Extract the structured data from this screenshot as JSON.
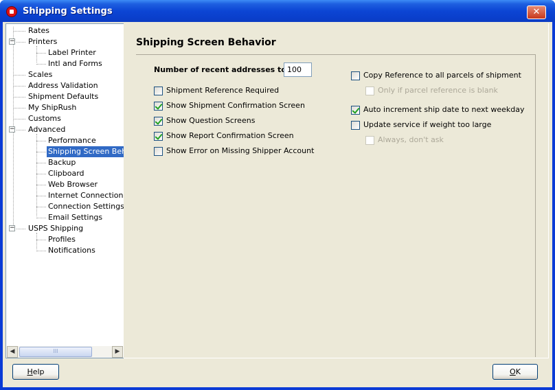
{
  "window": {
    "title": "Shipping Settings",
    "close_symbol": "✕"
  },
  "tree": {
    "items": [
      {
        "label": "Rates",
        "level": 0
      },
      {
        "label": "Printers",
        "level": 0,
        "expander": "−"
      },
      {
        "label": "Label Printer",
        "level": 1
      },
      {
        "label": "Intl and Forms",
        "level": 1
      },
      {
        "label": "Scales",
        "level": 0
      },
      {
        "label": "Address Validation",
        "level": 0
      },
      {
        "label": "Shipment Defaults",
        "level": 0
      },
      {
        "label": "My ShipRush",
        "level": 0
      },
      {
        "label": "Customs",
        "level": 0
      },
      {
        "label": "Advanced",
        "level": 0,
        "expander": "−"
      },
      {
        "label": "Performance",
        "level": 1
      },
      {
        "label": "Shipping Screen Beh",
        "level": 1,
        "selected": true
      },
      {
        "label": "Backup",
        "level": 1
      },
      {
        "label": "Clipboard",
        "level": 1
      },
      {
        "label": "Web Browser",
        "level": 1
      },
      {
        "label": "Internet Connection",
        "level": 1
      },
      {
        "label": "Connection Settings",
        "level": 1
      },
      {
        "label": "Email Settings",
        "level": 1
      },
      {
        "label": "USPS Shipping",
        "level": 0,
        "expander": "−"
      },
      {
        "label": "Profiles",
        "level": 1
      },
      {
        "label": "Notifications",
        "level": 1
      }
    ],
    "scroll_left": "◀",
    "scroll_right": "▶",
    "scroll_grip": "III"
  },
  "panel": {
    "title": "Shipping Screen Behavior",
    "recent_label": "Number of recent addresses to show",
    "recent_value": "100",
    "left_options": [
      {
        "label": "Shipment Reference Required",
        "checked": false
      },
      {
        "label": "Show Shipment Confirmation Screen",
        "checked": true
      },
      {
        "label": "Show Question Screens",
        "checked": true
      },
      {
        "label": "Show Report Confirmation Screen",
        "checked": true
      },
      {
        "label": "Show Error on Missing Shipper Account",
        "checked": false
      }
    ],
    "right_options": [
      {
        "label": "Copy Reference to all parcels of shipment",
        "checked": false
      },
      {
        "label": "Only if parcel reference is blank",
        "checked": false,
        "disabled": true
      },
      {
        "label": "Auto increment ship date to next weekday",
        "checked": true
      },
      {
        "label": "Update service if weight too large",
        "checked": false
      },
      {
        "label": "Always, don't ask",
        "checked": false,
        "disabled": true
      }
    ]
  },
  "buttons": {
    "help_pre": "",
    "help_u": "H",
    "help_post": "elp",
    "ok_pre": "",
    "ok_u": "O",
    "ok_post": "K"
  }
}
